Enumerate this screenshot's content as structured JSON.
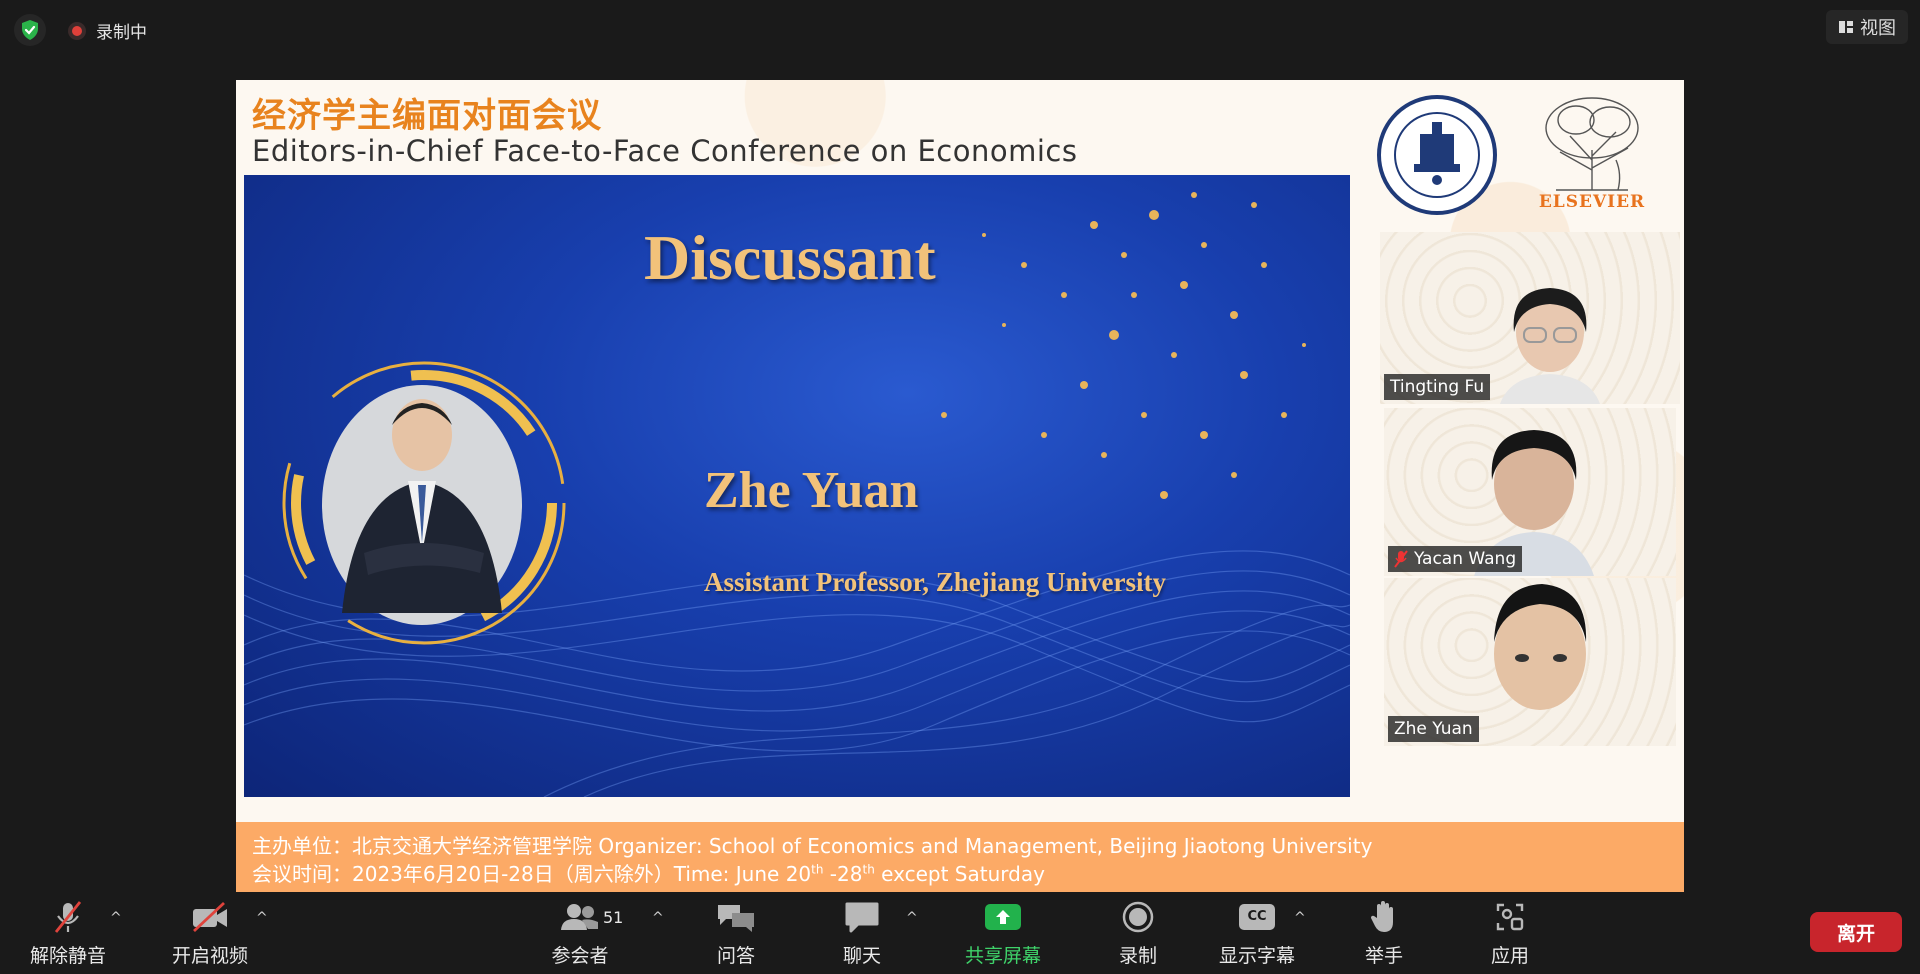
{
  "top": {
    "recording_label": "录制中",
    "view_label": "视图"
  },
  "slide": {
    "title_cn": "经济学主编面对面会议",
    "title_en": "Editors-in-Chief Face-to-Face Conference on Economics",
    "logo_elsevier": "ELSEVIER",
    "heading": "Discussant",
    "speaker_name": "Zhe Yuan",
    "speaker_title": "Assistant Professor, Zhejiang University",
    "footer_line1": "主办单位：北京交通大学经济管理学院 Organizer: School of Economics and Management, Beijing Jiaotong University",
    "footer_line2_prefix": "会议时间：2023年6月20日-28日（周六除外）Time: June 20",
    "footer_sup1": "th",
    "footer_mid": " -28",
    "footer_sup2": "th",
    "footer_suffix": " except Saturday"
  },
  "participants": [
    {
      "name": "Tingting Fu",
      "muted": false,
      "active": true
    },
    {
      "name": "Yacan Wang",
      "muted": true,
      "active": false
    },
    {
      "name": "Zhe Yuan",
      "muted": false,
      "active": false
    }
  ],
  "toolbar": {
    "unmute_label": "解除静音",
    "video_label": "开启视频",
    "participants_label": "参会者",
    "participants_count": "51",
    "qa_label": "问答",
    "chat_label": "聊天",
    "share_label": "共享屏幕",
    "record_label": "录制",
    "captions_label": "显示字幕",
    "captions_icon_text": "CC",
    "raise_hand_label": "举手",
    "apps_label": "应用",
    "leave_label": "离开"
  },
  "colors": {
    "accent_orange": "#e8831e",
    "gold": "#f2c27a",
    "share_green": "#3fd26a",
    "leave_red": "#c8252c",
    "active_outline": "#b9e55a"
  }
}
